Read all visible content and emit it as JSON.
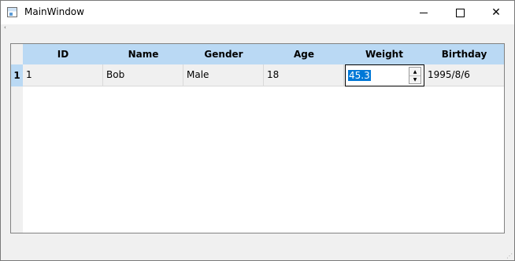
{
  "window": {
    "title": "MainWindow",
    "controls": {
      "minimize_icon": "minimize-icon",
      "maximize_icon": "maximize-icon",
      "close_glyph": "✕"
    }
  },
  "menubar": {
    "extension_glyph": "‹"
  },
  "table": {
    "columns": [
      "ID",
      "Name",
      "Gender",
      "Age",
      "Weight",
      "Birthday"
    ],
    "rows": [
      {
        "header": "1",
        "cells": [
          "1",
          "Bob",
          "Male",
          "18",
          "45.3",
          "1995/8/6"
        ]
      }
    ],
    "editor": {
      "value": "45.3",
      "up_glyph": "▲",
      "down_glyph": "▼"
    },
    "colors": {
      "header": "#bad9f4",
      "selection": "#0078d7"
    }
  },
  "statusbar": {
    "grip_glyph": "⋰"
  }
}
